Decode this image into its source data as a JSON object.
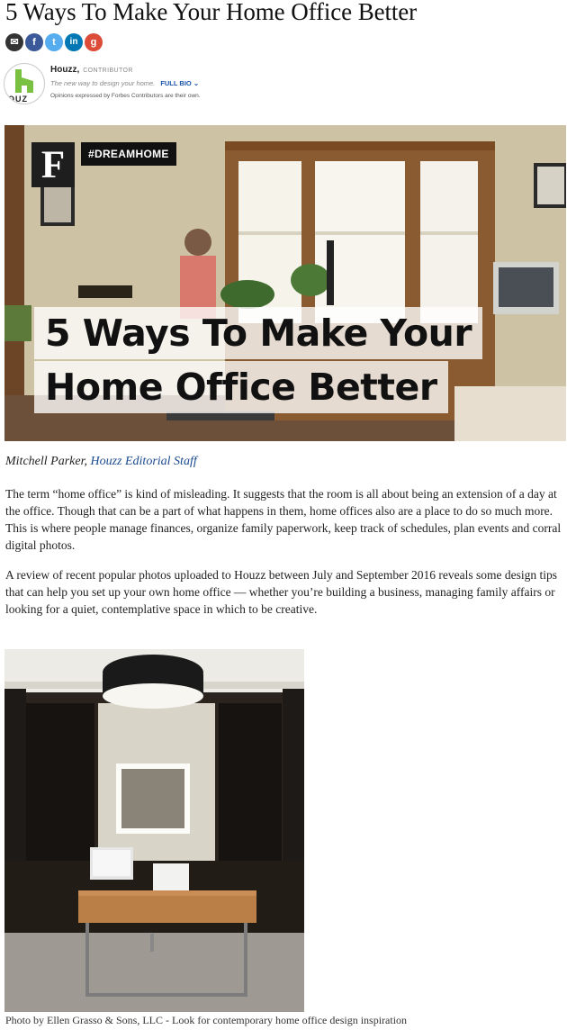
{
  "article": {
    "title": "5 Ways To Make Your Home Office Better",
    "byline_author": "Mitchell Parker, ",
    "byline_link": "Houzz Editorial Staff",
    "paragraphs": [
      "The term “home office” is kind of misleading. It suggests that the room is all about being an extension of a day at the office. Though that can be a part of what happens in them, home offices also are a place to do so much more. This is where people manage finances, organize family paperwork, keep track of schedules, plan events and corral digital photos.",
      "A review of recent popular photos uploaded to Houzz between July and September 2016 reveals some design tips that can help you set up your own home office — whether you’re building a business, managing family affairs or looking for a quiet, contemplative space in which to be creative."
    ],
    "photo_caption": "Photo by Ellen Grasso & Sons, LLC - Look for contemporary home office design inspiration"
  },
  "share": {
    "email": "✉",
    "facebook": "f",
    "twitter": "t",
    "linkedin": "in",
    "googleplus": "g"
  },
  "author": {
    "name": "Houzz,",
    "role": "CONTRIBUTOR",
    "tagline": "The new way to design your home.",
    "full_bio": "FULL BIO",
    "full_bio_chevron": "⌄",
    "disclaimer": "Opinions expressed by Forbes Contributors are their own.",
    "avatar_text": "OUZ"
  },
  "hero": {
    "logo_letter": "F",
    "hashtag": "#DREAMHOME",
    "line1": "5 Ways To Make Your",
    "line2": "Home Office Better"
  },
  "colors": {
    "link": "#1a4a8f",
    "houzz_green": "#7ac142",
    "facebook": "#3b5998",
    "twitter": "#55acee",
    "linkedin": "#0077b5",
    "googleplus": "#dd4b39"
  }
}
